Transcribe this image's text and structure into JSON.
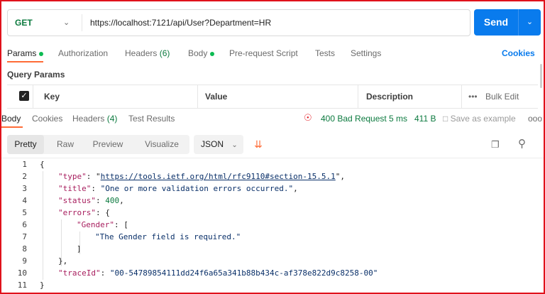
{
  "request": {
    "method": "GET",
    "url": "https://localhost:7121/api/User?Department=HR",
    "send_label": "Send"
  },
  "request_tabs": [
    {
      "label": "Params",
      "active": true,
      "dot": true
    },
    {
      "label": "Authorization",
      "active": false
    },
    {
      "label": "Headers",
      "count": "(6)",
      "active": false
    },
    {
      "label": "Body",
      "active": false,
      "dot": true
    },
    {
      "label": "Pre-request Script",
      "active": false
    },
    {
      "label": "Tests",
      "active": false
    },
    {
      "label": "Settings",
      "active": false
    }
  ],
  "cookies_label": "Cookies",
  "query_params": {
    "title": "Query Params",
    "columns": [
      "Key",
      "Value",
      "Description"
    ],
    "bulk_edit": "Bulk Edit",
    "more_dots": "•••"
  },
  "response_tabs": [
    {
      "label": "Body",
      "active": true
    },
    {
      "label": "Cookies",
      "active": false
    },
    {
      "label": "Headers",
      "count": "(4)",
      "active": false
    },
    {
      "label": "Test Results",
      "active": false
    }
  ],
  "response_status": {
    "status": "400 Bad Request",
    "time": "5 ms",
    "size": "411 B",
    "save_example": "Save as example",
    "more": "ooo"
  },
  "body_formats": [
    "Pretty",
    "Raw",
    "Preview",
    "Visualize"
  ],
  "body_format_active": "Pretty",
  "language": "JSON",
  "code_lines": [
    "1",
    "2",
    "3",
    "4",
    "5",
    "6",
    "7",
    "8",
    "9",
    "10",
    "11"
  ],
  "json_body": {
    "type_key": "\"type\"",
    "type_value": "https://tools.ietf.org/html/rfc9110#section-15.5.1",
    "title_key": "\"title\"",
    "title_value": "\"One or more validation errors occurred.\"",
    "status_key": "\"status\"",
    "status_value": "400",
    "errors_key": "\"errors\"",
    "gender_key": "\"Gender\"",
    "gender_msg": "\"The Gender field is required.\"",
    "traceid_key": "\"traceId\"",
    "traceid_value": "\"00-54789854111dd24f6a65a341b88b434c-af378e822d9c8258-00\""
  },
  "colors": {
    "send_blue": "#097bed",
    "accent_orange": "#ff6c37",
    "status_green": "#0c7a3f",
    "border_red": "#e0121b"
  }
}
